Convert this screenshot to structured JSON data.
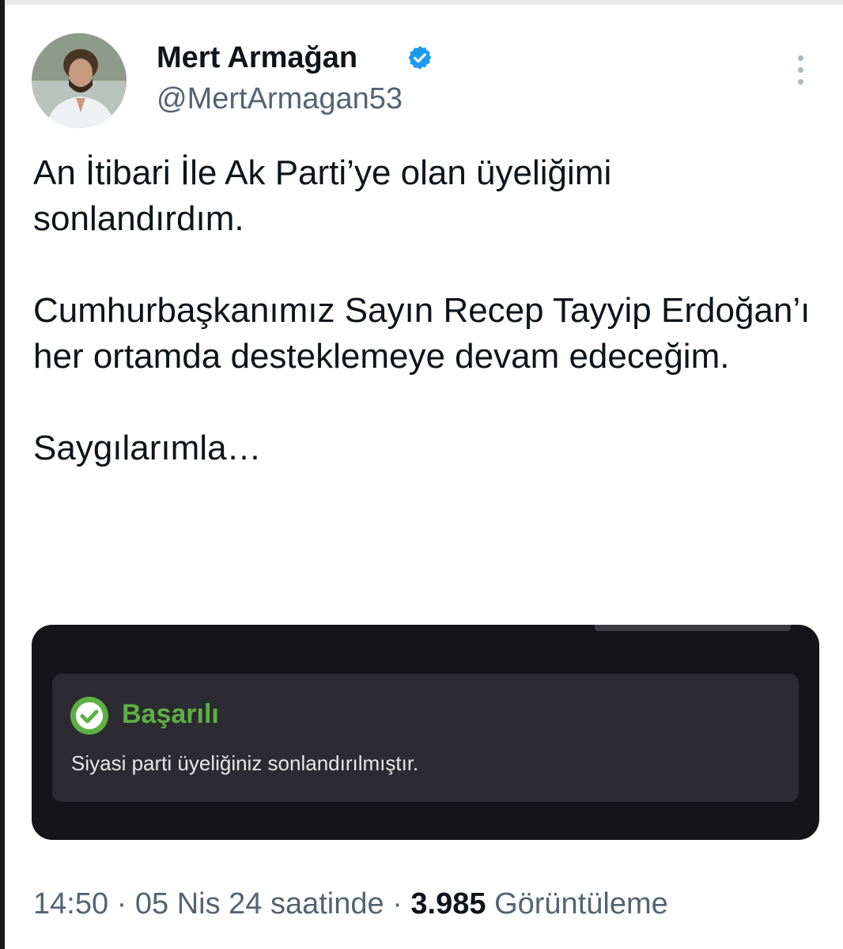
{
  "tweet": {
    "author_name": "Mert Armağan",
    "handle": "@MertArmagan53",
    "verified_icon": "verified-badge-icon",
    "more_icon": "more-vertical-icon",
    "paragraphs": [
      "An İtibari İle Ak Parti’ye olan üyeliğimi sonlandırdım.",
      "Cumhurbaşkanımız Sayın Recep Tayyip Erdoğan’ı her ortamda desteklemeye devam edeceğim.",
      "Saygılarımla…"
    ],
    "time": "14:50",
    "separator": "·",
    "date": "05 Nis 24 saatinde",
    "views_count": "3.985",
    "views_label": "Görüntüleme"
  },
  "attachment": {
    "status_icon": "check-circle-icon",
    "status_title": "Başarılı",
    "status_message": "Siyasi parti üyeliğiniz sonlandırılmıştır."
  },
  "colors": {
    "verified_blue": "#1d9bf0",
    "success_green": "#5fb043",
    "card_dark": "#141419",
    "toast_bg": "#2b2b31",
    "muted_text": "#536471"
  }
}
